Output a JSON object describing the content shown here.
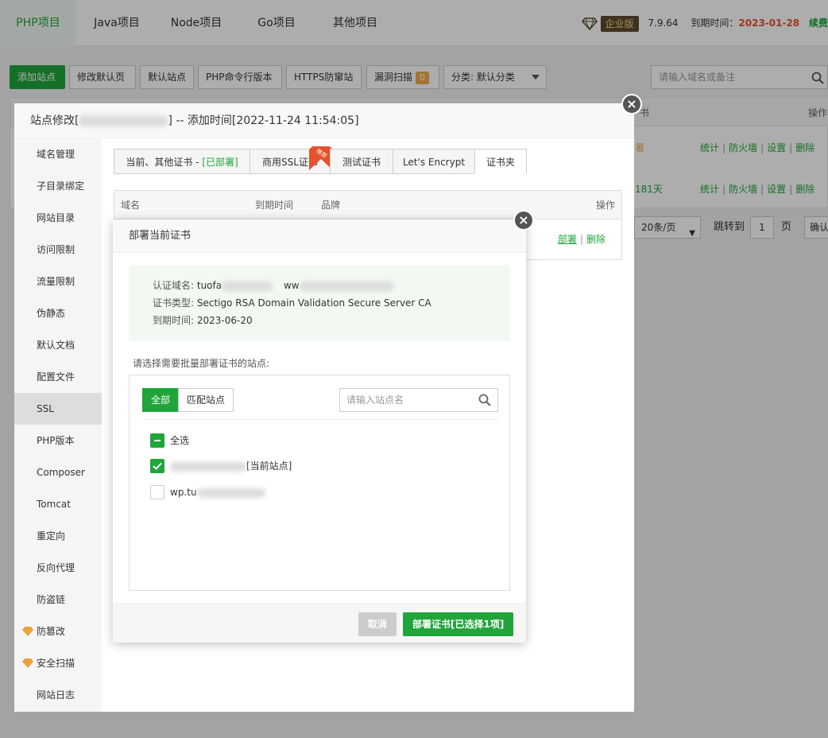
{
  "topnav": {
    "tabs": [
      "PHP项目",
      "Java项目",
      "Node项目",
      "Go项目",
      "其他项目"
    ],
    "edition": "企业版",
    "version": "7.9.64",
    "expire_label": "到期时间：",
    "expire_date": "2023-01-28",
    "renew": "续费"
  },
  "toolbar": {
    "add_site": "添加站点",
    "edit_default_page": "修改默认页",
    "default_site": "默认站点",
    "php_cli": "PHP命令行版本",
    "https_guard": "HTTPS防窜站",
    "vuln_scan": "漏洞扫描",
    "vuln_count": "0",
    "category": "分类: 默认分类",
    "search_placeholder": "请输入域名或备注"
  },
  "bg_table": {
    "col_fragment": "书",
    "col_ops": "操作",
    "row1_status": "署",
    "row2_status": "181天",
    "actions": [
      "统计",
      "防火墙",
      "设置",
      "删除"
    ]
  },
  "pager": {
    "per_page": "20条/页",
    "goto": "跳转到",
    "page": "1",
    "page_unit": "页",
    "confirm": "确认"
  },
  "site_dialog": {
    "title_prefix": "站点修改[",
    "title_suffix": "] -- 添加时间[2022-11-24 11:54:05]",
    "sidebar": [
      "域名管理",
      "子目录绑定",
      "网站目录",
      "访问限制",
      "流量限制",
      "伪静态",
      "默认文档",
      "配置文件",
      "SSL",
      "PHP版本",
      "Composer",
      "Tomcat",
      "重定向",
      "反向代理",
      "防盗链",
      "防篡改",
      "安全扫描",
      "网站日志"
    ],
    "cert_tabs": {
      "current": "当前、其他证书 - ",
      "current_status": "[已部署]",
      "commercial": "商用SSL证书",
      "hot": "推荐",
      "test": "测试证书",
      "letsencrypt": "Let's Encrypt",
      "folder": "证书夹"
    },
    "cert_table": {
      "col_domain": "域名",
      "col_expire": "到期时间",
      "col_brand": "品牌",
      "col_ops": "操作",
      "deploy": "部署",
      "delete": "删除"
    }
  },
  "deploy_dialog": {
    "title": "部署当前证书",
    "info": {
      "domain_label": "认证域名:",
      "domain_value_1": "tuofa",
      "domain_value_2": "ww",
      "type_label": "证书类型:",
      "type_value": "Sectigo RSA Domain Validation Secure Server CA",
      "expire_label": "到期时间:",
      "expire_value": "2023-06-20"
    },
    "choose_label": "请选择需要批量部署证书的站点:",
    "seg_all": "全部",
    "seg_match": "匹配站点",
    "search_placeholder": "请输入站点名",
    "select_all": "全选",
    "site1_tag": "[当前站点]",
    "site2_name": "wp.tu",
    "cancel": "取消",
    "deploy": "部署证书[已选择1项]"
  },
  "colors": {
    "accent": "#20a53a",
    "expire": "#e6522c"
  }
}
